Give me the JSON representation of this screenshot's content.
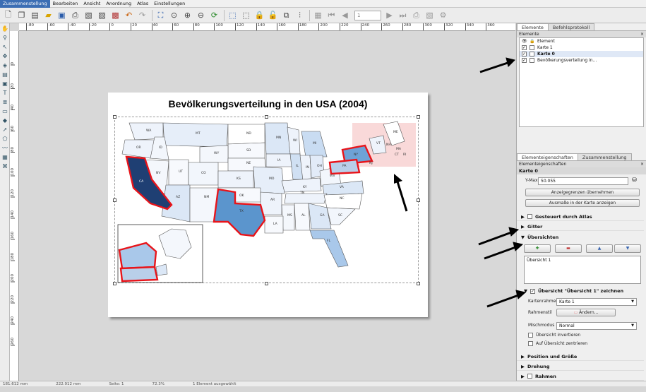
{
  "menu": [
    "Zusammenstellung",
    "Bearbeiten",
    "Ansicht",
    "Anordnung",
    "Atlas",
    "Einstellungen"
  ],
  "toolbar": {
    "page_value": "1"
  },
  "hruler_ticks": [
    "-80",
    "-60",
    "-40",
    "-20",
    "0",
    "20",
    "40",
    "60",
    "80",
    "100",
    "120",
    "140",
    "160",
    "180",
    "200",
    "220",
    "240",
    "260",
    "280",
    "300",
    "320",
    "340",
    "360"
  ],
  "vruler_ticks": [
    "0",
    "20",
    "40",
    "60",
    "80",
    "100",
    "120",
    "140",
    "160",
    "180",
    "200",
    "220",
    "240",
    "260"
  ],
  "map": {
    "title": "Bevölkerungsverteilung in den USA (2004)",
    "highlight_color": "#e8141a",
    "state_labels": [
      "WA",
      "MT",
      "ND",
      "MN",
      "OR",
      "ID",
      "SD",
      "WI",
      "MI",
      "NY",
      "WY",
      "IA",
      "NE",
      "PA",
      "NV",
      "UT",
      "CO",
      "IL",
      "IN",
      "OH",
      "CA",
      "KS",
      "MO",
      "KY",
      "WV",
      "VA",
      "AZ",
      "NM",
      "OK",
      "TN",
      "NC",
      "AR",
      "SC",
      "TX",
      "MS",
      "AL",
      "GA",
      "LA",
      "FL",
      "ME",
      "VT",
      "NH",
      "MA",
      "CT",
      "RI",
      "NJ"
    ]
  },
  "status": {
    "x": "181.612 mm",
    "y": "222.912 mm",
    "page": "Seite: 1",
    "zoom": "72.3%",
    "selection": "1 Element ausgewählt"
  },
  "panel": {
    "tabs": [
      "Elemente",
      "Befehlsprotokoll"
    ],
    "items_title": "Elemente",
    "items_header": "Element",
    "items": [
      "Karte 1",
      "Karte 0",
      "Bevölkerungsverteilung in..."
    ],
    "props_tabs": [
      "Elementeigenschaften",
      "Zusammenstellung"
    ],
    "props_title": "Elementeigenschaften",
    "item_name": "Karte 0",
    "ymax_label": "Y-Max",
    "ymax_value": "50.055",
    "btn_extent": "Anzeigegrenzen übernehmen",
    "btn_show": "Ausmaße in der Karte anzeigen",
    "sec_atlas": "Gesteuert durch Atlas",
    "sec_grid": "Gitter",
    "sec_overviews": "Übersichten",
    "overview_item": "Übersicht 1",
    "sec_draw": "Übersicht \"Übersicht 1\" zeichnen",
    "frame_label": "Kartenrahmen",
    "frame_value": "Karte 1",
    "style_label": "Rahmenstil",
    "style_btn": "Ändern...",
    "blend_label": "Mischmodus",
    "blend_value": "Normal",
    "invert_label": "Übersicht invertieren",
    "center_label": "Auf Übersicht zentrieren",
    "sec_position": "Position und Größe",
    "sec_rotation": "Drehung",
    "sec_frame": "Rahmen"
  }
}
